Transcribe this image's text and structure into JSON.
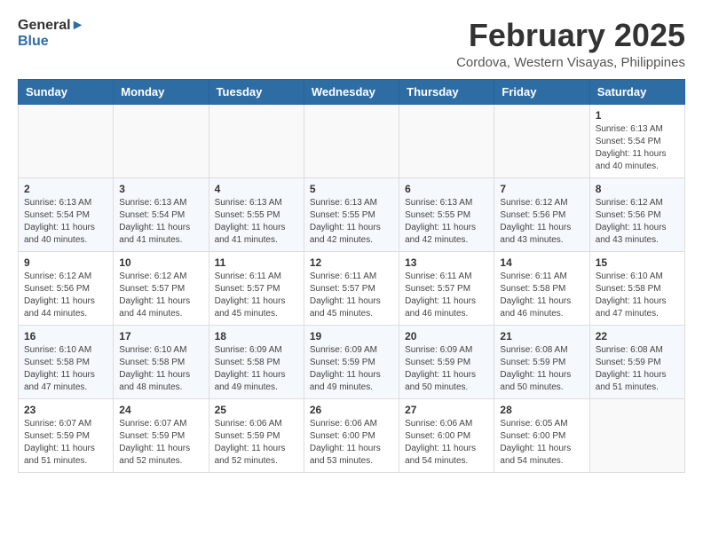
{
  "header": {
    "logo_general": "General",
    "logo_blue": "Blue",
    "month_year": "February 2025",
    "location": "Cordova, Western Visayas, Philippines"
  },
  "weekdays": [
    "Sunday",
    "Monday",
    "Tuesday",
    "Wednesday",
    "Thursday",
    "Friday",
    "Saturday"
  ],
  "weeks": [
    [
      {
        "day": "",
        "info": ""
      },
      {
        "day": "",
        "info": ""
      },
      {
        "day": "",
        "info": ""
      },
      {
        "day": "",
        "info": ""
      },
      {
        "day": "",
        "info": ""
      },
      {
        "day": "",
        "info": ""
      },
      {
        "day": "1",
        "info": "Sunrise: 6:13 AM\nSunset: 5:54 PM\nDaylight: 11 hours\nand 40 minutes."
      }
    ],
    [
      {
        "day": "2",
        "info": "Sunrise: 6:13 AM\nSunset: 5:54 PM\nDaylight: 11 hours\nand 40 minutes."
      },
      {
        "day": "3",
        "info": "Sunrise: 6:13 AM\nSunset: 5:54 PM\nDaylight: 11 hours\nand 41 minutes."
      },
      {
        "day": "4",
        "info": "Sunrise: 6:13 AM\nSunset: 5:55 PM\nDaylight: 11 hours\nand 41 minutes."
      },
      {
        "day": "5",
        "info": "Sunrise: 6:13 AM\nSunset: 5:55 PM\nDaylight: 11 hours\nand 42 minutes."
      },
      {
        "day": "6",
        "info": "Sunrise: 6:13 AM\nSunset: 5:55 PM\nDaylight: 11 hours\nand 42 minutes."
      },
      {
        "day": "7",
        "info": "Sunrise: 6:12 AM\nSunset: 5:56 PM\nDaylight: 11 hours\nand 43 minutes."
      },
      {
        "day": "8",
        "info": "Sunrise: 6:12 AM\nSunset: 5:56 PM\nDaylight: 11 hours\nand 43 minutes."
      }
    ],
    [
      {
        "day": "9",
        "info": "Sunrise: 6:12 AM\nSunset: 5:56 PM\nDaylight: 11 hours\nand 44 minutes."
      },
      {
        "day": "10",
        "info": "Sunrise: 6:12 AM\nSunset: 5:57 PM\nDaylight: 11 hours\nand 44 minutes."
      },
      {
        "day": "11",
        "info": "Sunrise: 6:11 AM\nSunset: 5:57 PM\nDaylight: 11 hours\nand 45 minutes."
      },
      {
        "day": "12",
        "info": "Sunrise: 6:11 AM\nSunset: 5:57 PM\nDaylight: 11 hours\nand 45 minutes."
      },
      {
        "day": "13",
        "info": "Sunrise: 6:11 AM\nSunset: 5:57 PM\nDaylight: 11 hours\nand 46 minutes."
      },
      {
        "day": "14",
        "info": "Sunrise: 6:11 AM\nSunset: 5:58 PM\nDaylight: 11 hours\nand 46 minutes."
      },
      {
        "day": "15",
        "info": "Sunrise: 6:10 AM\nSunset: 5:58 PM\nDaylight: 11 hours\nand 47 minutes."
      }
    ],
    [
      {
        "day": "16",
        "info": "Sunrise: 6:10 AM\nSunset: 5:58 PM\nDaylight: 11 hours\nand 47 minutes."
      },
      {
        "day": "17",
        "info": "Sunrise: 6:10 AM\nSunset: 5:58 PM\nDaylight: 11 hours\nand 48 minutes."
      },
      {
        "day": "18",
        "info": "Sunrise: 6:09 AM\nSunset: 5:58 PM\nDaylight: 11 hours\nand 49 minutes."
      },
      {
        "day": "19",
        "info": "Sunrise: 6:09 AM\nSunset: 5:59 PM\nDaylight: 11 hours\nand 49 minutes."
      },
      {
        "day": "20",
        "info": "Sunrise: 6:09 AM\nSunset: 5:59 PM\nDaylight: 11 hours\nand 50 minutes."
      },
      {
        "day": "21",
        "info": "Sunrise: 6:08 AM\nSunset: 5:59 PM\nDaylight: 11 hours\nand 50 minutes."
      },
      {
        "day": "22",
        "info": "Sunrise: 6:08 AM\nSunset: 5:59 PM\nDaylight: 11 hours\nand 51 minutes."
      }
    ],
    [
      {
        "day": "23",
        "info": "Sunrise: 6:07 AM\nSunset: 5:59 PM\nDaylight: 11 hours\nand 51 minutes."
      },
      {
        "day": "24",
        "info": "Sunrise: 6:07 AM\nSunset: 5:59 PM\nDaylight: 11 hours\nand 52 minutes."
      },
      {
        "day": "25",
        "info": "Sunrise: 6:06 AM\nSunset: 5:59 PM\nDaylight: 11 hours\nand 52 minutes."
      },
      {
        "day": "26",
        "info": "Sunrise: 6:06 AM\nSunset: 6:00 PM\nDaylight: 11 hours\nand 53 minutes."
      },
      {
        "day": "27",
        "info": "Sunrise: 6:06 AM\nSunset: 6:00 PM\nDaylight: 11 hours\nand 54 minutes."
      },
      {
        "day": "28",
        "info": "Sunrise: 6:05 AM\nSunset: 6:00 PM\nDaylight: 11 hours\nand 54 minutes."
      },
      {
        "day": "",
        "info": ""
      }
    ]
  ]
}
